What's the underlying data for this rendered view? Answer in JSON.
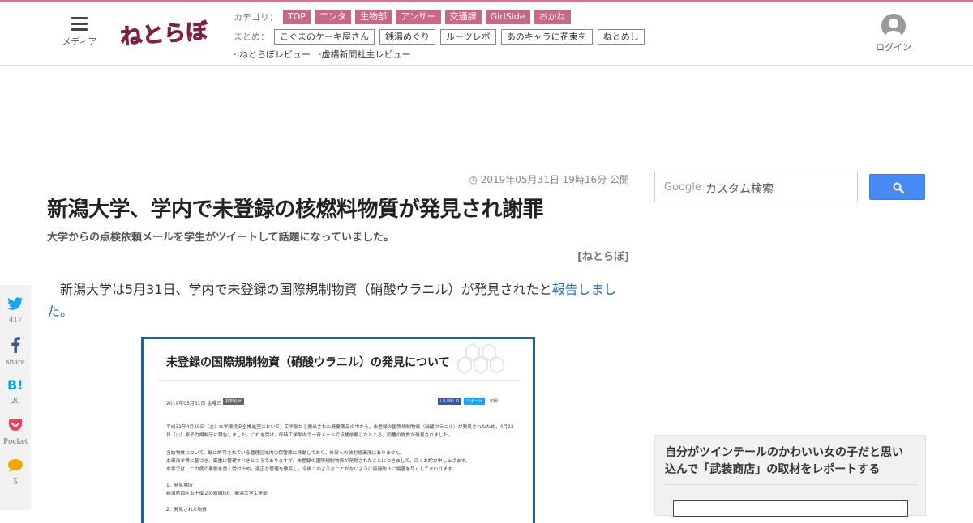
{
  "header": {
    "menu_label": "メディア",
    "logo_text": "ねとらぼ",
    "category_label": "カテゴリ：",
    "categories": [
      "TOP",
      "エンタ",
      "生物部",
      "アンサー",
      "交通課",
      "GirlSide",
      "おかね"
    ],
    "matome_label": "まとめ：",
    "matome": [
      "こぐまのケーキ屋さん",
      "銭湯めぐり",
      "ルーツレポ",
      "あのキャラに花束を",
      "ねとめし"
    ],
    "reviews": [
      "· ねとらぼレビュー",
      "·虚構新聞社主レビュー"
    ],
    "login_label": "ログイン"
  },
  "article": {
    "date": "2019年05月31日 19時16分 公開",
    "title": "新潟大学、学内で未登録の核燃料物質が発見され謝罪",
    "subtitle": "大学からの点検依頼メールを学生がツイートして話題になっていました。",
    "source": "[ねとらぼ]",
    "body_text": "　新潟大学は5月31日、学内で未登録の国際規制物資（硝酸ウラニル）が発見されたと",
    "body_link": "報告しました。"
  },
  "figure": {
    "title": "未登録の国際規制物資（硝酸ウラニル）の発見について",
    "date": "2019年05月31日 金曜日",
    "badge": "お知らせ",
    "share_like": "いいね！0",
    "share_tweet": "ツイート",
    "share_print": "印刷",
    "para1": "平成31年4月19日（金）本学環境安全推進室において，工学部から搬出された廃棄薬品の中から，未登録の国際規制物資（硝酸ウラニル）が発見されたため，4月23日（火）原子力規制庁に報告しました。これを受け，即時工学部内で一斉メールで点検依頼したところ，同種の物質が発見されました。",
    "para2": "当該物質について，既に許可されている管理区域内の保管庫に移動しており，外部への放射線漏洩はありません。",
    "para3": "本来法令等に基づき，厳重に管理すべきところでありますが，未登録の国際規制物資が発見されたことにつきまして，深くお詫び申し上げます。",
    "para4": "本学では，この度の事態を重く受け止め，適正な管理を徹底し，今後このようなことがないように再発防止に最善を尽くしてまいります。",
    "item1": "1．発見場所",
    "item1_detail": "新潟県西区五十嵐２の町8050　新潟大学工学部",
    "item2": "2．発見された物質"
  },
  "social": [
    {
      "icon": "twitter-icon",
      "count": "417",
      "color": "#1da1f2"
    },
    {
      "icon": "facebook-icon",
      "count": "share",
      "color": "#3b5998"
    },
    {
      "icon": "hatena-bookmark-icon",
      "count": "20",
      "color": "#00a4de"
    },
    {
      "icon": "pocket-icon",
      "count": "Pocket",
      "color": "#ef4056"
    },
    {
      "icon": "comment-icon",
      "count": "5",
      "color": "#f0a500"
    }
  ],
  "sidebar": {
    "search_brand": "Google",
    "search_placeholder": "カスタム検索",
    "widget_title": "自分がツインテールのかわいい女の子だと思い込んで「武装商店」の取材をレポートする"
  },
  "colors": {
    "accent": "#c86887",
    "link": "#1f6ab3",
    "search_button": "#4a8af4"
  }
}
